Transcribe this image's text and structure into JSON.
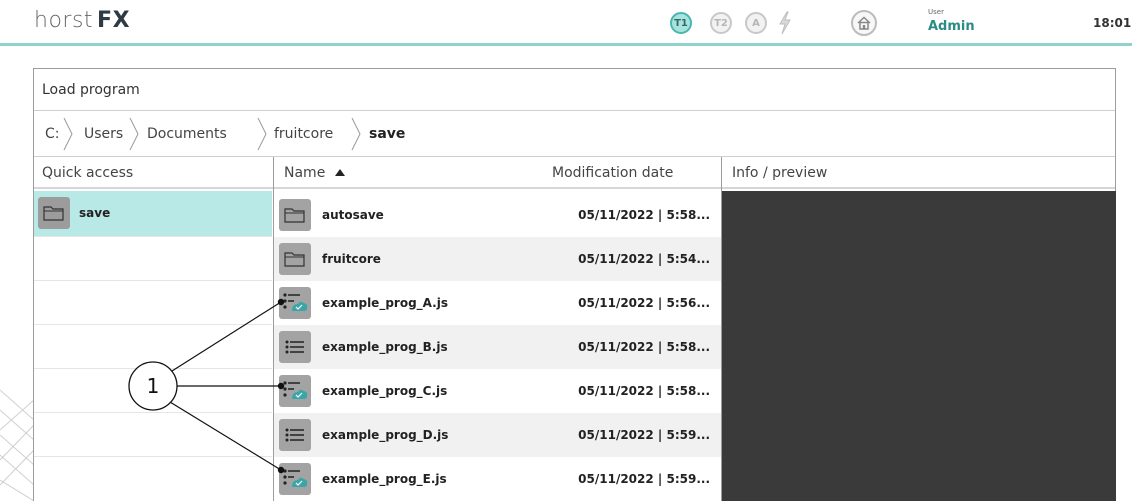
{
  "app": {
    "brand_light": "horst",
    "brand_bold": "FX",
    "modes": [
      "T1",
      "T2",
      "A"
    ],
    "active_mode": "T1",
    "user_caption": "User",
    "user_name": "Admin",
    "time": "18:01",
    "accent_color": "#49b7ae"
  },
  "dialog": {
    "title": "Load program",
    "breadcrumbs": [
      "C:",
      "Users",
      "Documents",
      "fruitcore",
      "save"
    ],
    "columns": {
      "quick_access": "Quick access",
      "name": "Name",
      "name_sort_icon": "sort-ascending-icon",
      "date": "Modification date",
      "preview": "Info / preview"
    },
    "quick_access": [
      {
        "label": "save",
        "icon": "folder-icon",
        "selected": true
      }
    ],
    "files": [
      {
        "name": "autosave",
        "date": "05/11/2022 | 5:58...",
        "icon": "folder-icon"
      },
      {
        "name": "fruitcore",
        "date": "05/11/2022 | 5:54...",
        "icon": "folder-icon"
      },
      {
        "name": "example_prog_A.js",
        "date": "05/11/2022 | 5:56...",
        "icon": "program-cloud-icon"
      },
      {
        "name": "example_prog_B.js",
        "date": "05/11/2022 | 5:58...",
        "icon": "program-list-icon"
      },
      {
        "name": "example_prog_C.js",
        "date": "05/11/2022 | 5:58...",
        "icon": "program-cloud-icon"
      },
      {
        "name": "example_prog_D.js",
        "date": "05/11/2022 | 5:59...",
        "icon": "program-list-icon"
      },
      {
        "name": "example_prog_E.js",
        "date": "05/11/2022 | 5:59...",
        "icon": "program-cloud-icon"
      }
    ]
  },
  "callout": {
    "number": "1"
  }
}
